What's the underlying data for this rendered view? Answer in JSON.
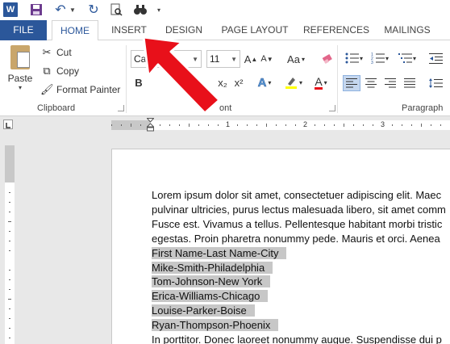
{
  "qat": {
    "app_icon_label": "W",
    "icons": [
      "word-app-icon",
      "save-icon",
      "undo-icon",
      "redo-icon",
      "print-preview-icon",
      "find-icon"
    ]
  },
  "tabs": {
    "file": "FILE",
    "home": "HOME",
    "insert": "INSERT",
    "design": "DESIGN",
    "page_layout": "PAGE LAYOUT",
    "references": "REFERENCES",
    "mailings": "MAILINGS"
  },
  "clipboard": {
    "paste": "Paste",
    "cut": "Cut",
    "copy": "Copy",
    "format_painter": "Format Painter",
    "group_label": "Clipboard"
  },
  "font": {
    "font_name_partial": "Cal",
    "font_size": "11",
    "grow_label": "A",
    "shrink_label": "A",
    "case_label": "Aa",
    "bold": "B",
    "subscript": "x₂",
    "superscript": "x²",
    "text_effects": "A",
    "font_color": "A",
    "group_label_partial": "ont"
  },
  "paragraph": {
    "group_label": "Paragraph"
  },
  "ruler": {
    "numbers": [
      "1",
      "2",
      "3"
    ]
  },
  "document": {
    "lines": [
      "Lorem ipsum dolor sit amet, consectetuer adipiscing elit. Maec",
      "pulvinar ultricies, purus lectus malesuada libero, sit amet comm",
      "Fusce est. Vivamus a tellus. Pellentesque habitant morbi tristic",
      "egestas. Proin pharetra nonummy pede. Mauris et orci. Aenea"
    ],
    "selected_lines": [
      "First Name-Last Name-City",
      "Mike-Smith-Philadelphia",
      "Tom-Johnson-New York",
      "Erica-Williams-Chicago",
      "Louise-Parker-Boise",
      "Ryan-Thompson-Phoenix"
    ],
    "after_line": "In porttitor. Donec laoreet nonummy augue. Suspendisse dui p"
  },
  "colors": {
    "accent": "#2b579a",
    "selection": "#c7c7c7",
    "arrow": "#e8101a"
  }
}
